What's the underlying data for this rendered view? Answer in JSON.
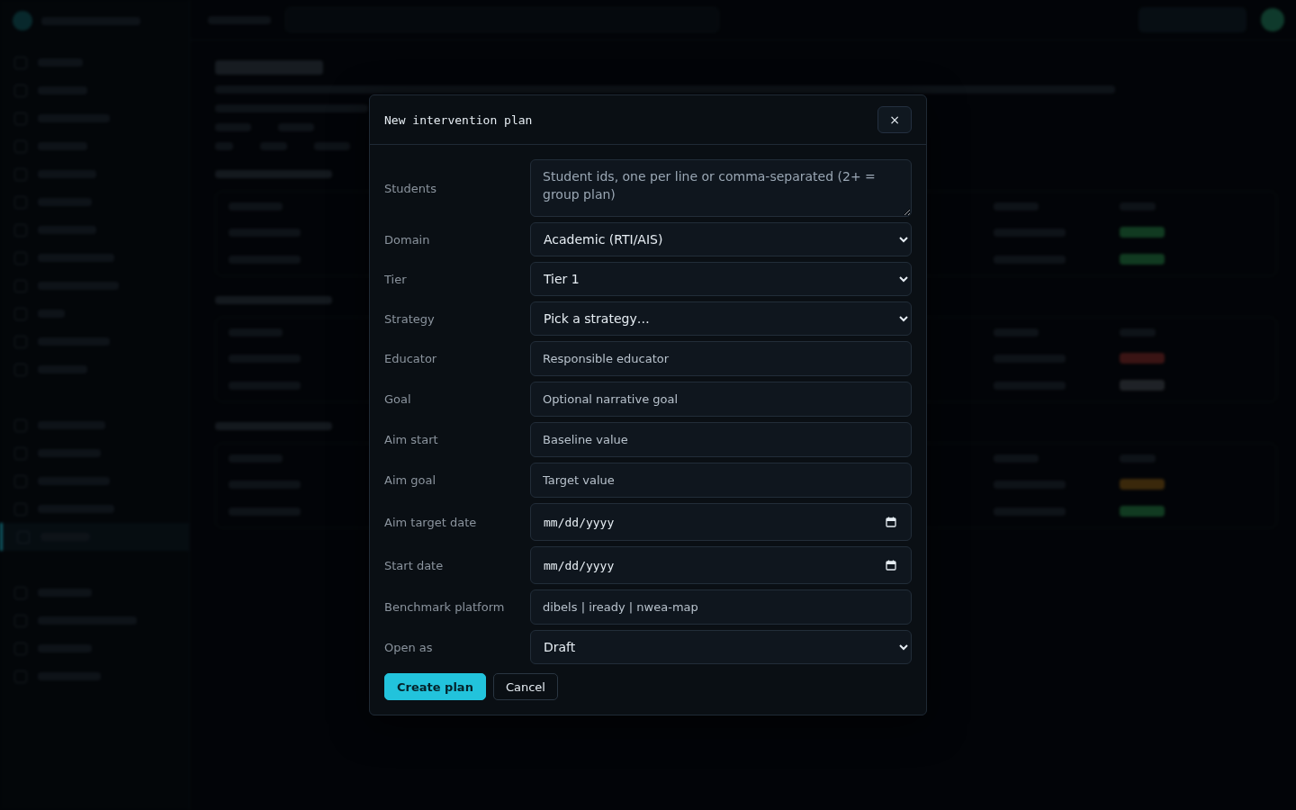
{
  "modal": {
    "title": "New intervention plan",
    "close": "×",
    "fields": [
      {
        "label": "Students",
        "kind": "textarea",
        "placeholder": "Student ids, one per line or comma-separated (2+ = group plan)"
      },
      {
        "label": "Domain",
        "kind": "select",
        "value": "Academic (RTI/AIS)"
      },
      {
        "label": "Tier",
        "kind": "select",
        "value": "Tier 1"
      },
      {
        "label": "Strategy",
        "kind": "select",
        "value": "Pick a strategy…"
      },
      {
        "label": "Educator",
        "kind": "text",
        "placeholder": "Responsible educator"
      },
      {
        "label": "Goal",
        "kind": "text",
        "placeholder": "Optional narrative goal"
      },
      {
        "label": "Aim start",
        "kind": "text",
        "placeholder": "Baseline value"
      },
      {
        "label": "Aim goal",
        "kind": "text",
        "placeholder": "Target value"
      },
      {
        "label": "Aim target date",
        "kind": "date",
        "value": "mm/dd/yyyy"
      },
      {
        "label": "Start date",
        "kind": "date",
        "value": "mm/dd/yyyy"
      },
      {
        "label": "Benchmark platform",
        "kind": "text",
        "placeholder": "dibels | iready | nwea-map"
      },
      {
        "label": "Open as",
        "kind": "select",
        "value": "Draft"
      }
    ],
    "actions": [
      {
        "label": "Create plan",
        "kind": "primary"
      },
      {
        "label": "Cancel",
        "kind": "secondary"
      }
    ]
  }
}
